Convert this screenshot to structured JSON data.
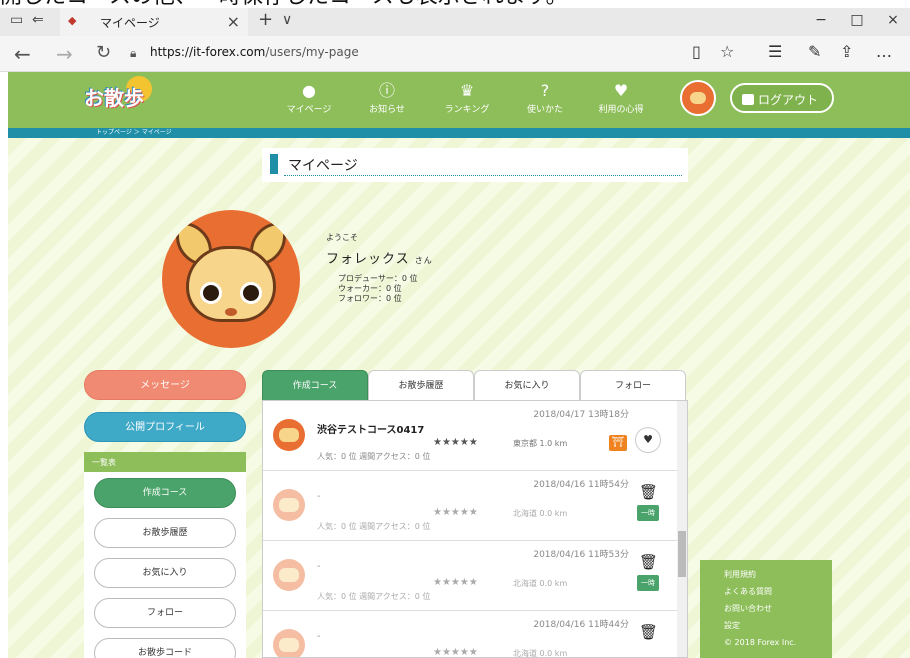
{
  "caption": "開したコースの他、一時保存したコースも表示されます。",
  "browser": {
    "tab_title": "マイページ",
    "new_tab_icon": "+",
    "url_host": "https://it-forex.com",
    "url_path": "/users/my-page"
  },
  "header": {
    "logo": "お散歩",
    "nav": [
      {
        "label": "マイページ",
        "icon": "person-icon"
      },
      {
        "label": "お知らせ",
        "icon": "info-icon"
      },
      {
        "label": "ランキング",
        "icon": "crown-icon"
      },
      {
        "label": "使いかた",
        "icon": "question-icon"
      },
      {
        "label": "利用の心得",
        "icon": "heart-icon"
      }
    ],
    "logout_label": "ログアウト"
  },
  "breadcrumb": "トップページ  ＞  マイページ",
  "page_title": "マイページ",
  "profile": {
    "welcome": "ようこそ",
    "name": "フォレックス",
    "suffix": "さん",
    "rank_producer": "プロデューサー：0 位",
    "rank_walker": "ウォーカー：0 位",
    "rank_follower": "フォロワー：0 位"
  },
  "left": {
    "message_label": "メッセージ",
    "public_profile_label": "公開プロフィール",
    "list_header": "一覧表",
    "list_items": [
      "作成コース",
      "お散歩履歴",
      "お気に入り",
      "フォロー",
      "お散歩コード"
    ]
  },
  "tabs": [
    "作成コース",
    "お散歩履歴",
    "お気に入り",
    "フォロー"
  ],
  "courses": [
    {
      "date": "2018/04/17 13時18分",
      "title": "渋谷テストコース0417",
      "stars": "★★★★★",
      "pref": "東京都  1.0 km",
      "stats": "人気：0 位   週間アクセス：0 位",
      "badge": "⛩"
    },
    {
      "date": "2018/04/16 11時54分",
      "title": "-",
      "stars": "★★★★★",
      "pref": "北海道  0.0 km",
      "stats": "人気：0 位   週間アクセス：0 位",
      "badge": "一時"
    },
    {
      "date": "2018/04/16 11時53分",
      "title": "-",
      "stars": "★★★★★",
      "pref": "北海道  0.0 km",
      "stats": "人気：0 位   週間アクセス：0 位",
      "badge": "一時"
    },
    {
      "date": "2018/04/16 11時44分",
      "title": "-",
      "stars": "★★★★★",
      "pref": "北海道  0.0 km",
      "stats": "",
      "badge": ""
    }
  ],
  "footer": [
    "利用規約",
    "よくある質問",
    "お問い合わせ",
    "設定",
    "© 2018 Forex Inc."
  ]
}
